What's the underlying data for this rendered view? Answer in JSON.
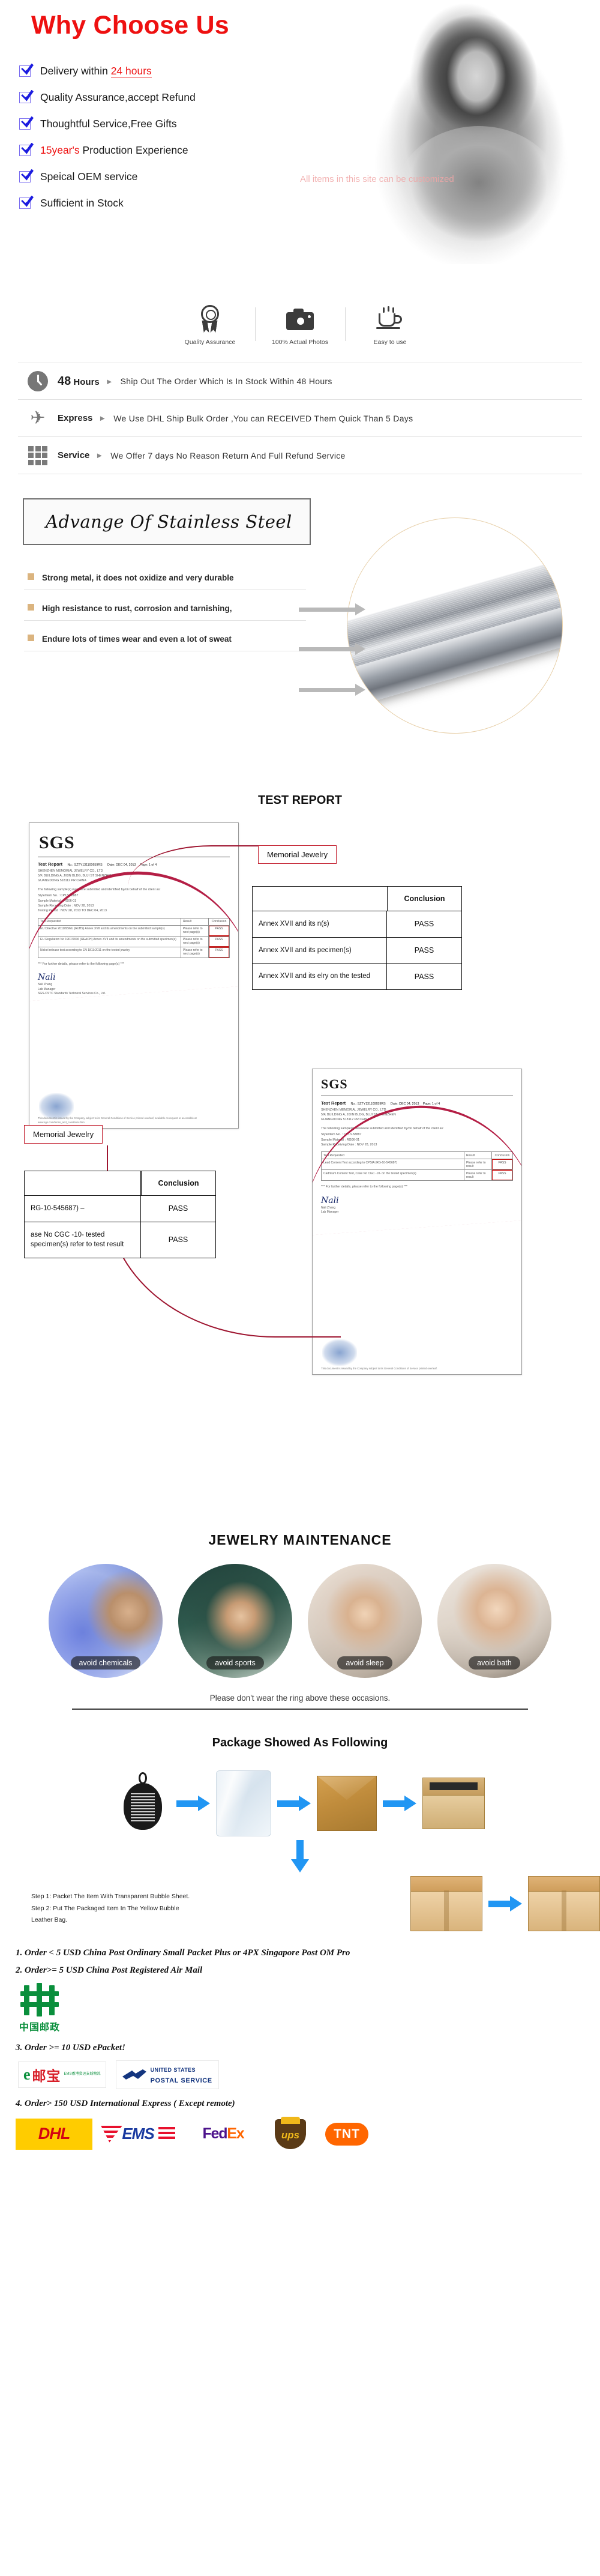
{
  "why": {
    "title": "Why Choose Us",
    "watermark": "All items in this site can be customized",
    "items": [
      {
        "pre": "Delivery within ",
        "hl": "24 hours",
        "hl_style": "underline",
        "post": ""
      },
      {
        "pre": "Quality Assurance,accept Refund",
        "hl": "",
        "hl_style": "",
        "post": ""
      },
      {
        "pre": "Thoughtful Service,Free Gifts",
        "hl": "",
        "hl_style": "",
        "post": ""
      },
      {
        "pre": "",
        "hl": "15year's",
        "hl_style": "plain",
        "post": " Production Experience"
      },
      {
        "pre": "Speical OEM service",
        "hl": "",
        "hl_style": "",
        "post": ""
      },
      {
        "pre": "Sufficient in Stock",
        "hl": "",
        "hl_style": "",
        "post": ""
      }
    ]
  },
  "badges": [
    {
      "icon": "quality-medal-icon",
      "caption": "Quality Assurance"
    },
    {
      "icon": "camera-icon",
      "caption": "100% Actual Photos"
    },
    {
      "icon": "coffee-cup-icon",
      "caption": "Easy to use"
    }
  ],
  "services": [
    {
      "icon": "clock-icon",
      "lead_num": "48",
      "lead": "Hours",
      "body": "Ship Out The Order Which Is In Stock Within 48 Hours"
    },
    {
      "icon": "airplane-icon",
      "lead_num": "",
      "lead": "Express",
      "body": "We Use DHL Ship Bulk Order ,You can RECEIVED Them Quick Than 5 Days"
    },
    {
      "icon": "grid-icon",
      "lead_num": "",
      "lead": "Service",
      "body": "We Offer 7 days No Reason Return And Full Refund Service"
    }
  ],
  "steel": {
    "heading": "Advange Of Stainless Steel",
    "points": [
      "Strong metal, it does not oxidize and very durable",
      "High resistance to rust, corrosion and tarnishing,",
      "Endure lots of times wear and even a lot of sweat"
    ]
  },
  "test_report": {
    "title": "TEST REPORT",
    "label_a": "Memorial Jewelry",
    "label_b": "Memorial Jewelry",
    "table_a": {
      "header_left": "",
      "header_right": "Conclusion",
      "rows": [
        {
          "left": "Annex XVII and its n(s)",
          "right": "PASS"
        },
        {
          "left": "Annex XVII and its pecimen(s)",
          "right": "PASS"
        },
        {
          "left": "Annex XVII and its elry on the tested",
          "right": "PASS"
        }
      ]
    },
    "table_b": {
      "header_right": "Conclusion",
      "rows": [
        {
          "left": "RG-10-545687) –",
          "right": "PASS"
        },
        {
          "left": "ase No CGC -10- tested specimen(s)  refer to test result",
          "right": "PASS"
        }
      ]
    },
    "doc_a": {
      "logo": "SGS",
      "heading": "Test Report",
      "meta_no": "No.: SZTY131100659RS",
      "meta_date": "Date: DEC 04, 2013",
      "meta_page": "Page: 1 of 4",
      "client_lines": [
        "SHENZHEN MEMORIAL JEWELRY CO., LTD",
        "5/F, BUILDING A, JIXIN BLDG, BUJI ST SHENZHEN",
        "GUANGDONG 518112 PR CHINA"
      ],
      "intro": "The following sample(s) was/were submitted and identified by/on behalf of the client as:",
      "kv": [
        "Style/Item No.   : CP13-58887",
        "Sample Material  : RG06-01",
        "Sample Receiving Date : NOV 28, 2013",
        "Testing Period   : NOV 28, 2013 TO DEC 04, 2013"
      ],
      "table_head": [
        "Test Requested",
        "Result",
        "Conclusion"
      ],
      "table_rows": [
        [
          "EU Directive 2011/65/EU (RoHS) Annex XVII and its amendments on the submitted sample(s)",
          "Please refer to next page(s)",
          "PASS"
        ],
        [
          "EU Regulation No 1907/2006 (REACH) Annex XVII and its amendments on the submitted specimen(s)",
          "Please refer to next page(s)",
          "PASS"
        ],
        [
          "Nickel release test according to EN 1811:2011 on the tested jewelry",
          "Please refer to next page(s)",
          "PASS"
        ]
      ],
      "note": "*** For further details, please refer to the following page(s) ***",
      "signature": "Nali",
      "sign_sub": [
        "Nali Zhang",
        "Lab Manager",
        "SGS-CSTC Standards Technical Services Co., Ltd."
      ],
      "footer": "This document is issued by the Company subject to its General Conditions of Service printed overleaf, available on request or accessible at www.sgs.com/terms_and_conditions.htm"
    },
    "doc_b": {
      "logo": "SGS",
      "heading": "Test Report",
      "meta_no": "No.: SZTY131100659RS",
      "meta_date": "Date: DEC 04, 2013",
      "meta_page": "Page: 1 of 4",
      "client_lines": [
        "SHENZHEN MEMORIAL JEWELRY CO., LTD",
        "5/F, BUILDING A, JIXIN BLDG, BUJI ST SHENZHEN",
        "GUANGDONG 518112 PR CHINA"
      ],
      "intro": "The following sample(s) was/were submitted and identified by/on behalf of the client as:",
      "kv": [
        "Style/Item No.   : CP13-58887",
        "Sample Material  : RG06-01",
        "Sample Receiving Date : NOV 28, 2013"
      ],
      "table_head": [
        "Test Requested",
        "Result",
        "Conclusion"
      ],
      "table_rows": [
        [
          "Lead Content Test according to CPSIA (RG-10-545687)",
          "Please refer to result",
          "PASS"
        ],
        [
          "Cadmium Content Test, Case No CGC -10- on the tested specimen(s)",
          "Please refer to result",
          "PASS"
        ]
      ],
      "note": "*** For further details, please refer to the following page(s) ***",
      "signature": "Nali",
      "sign_sub": [
        "Nali Zhang",
        "Lab Manager"
      ],
      "footer": "This document is issued by the Company subject to its General Conditions of Service printed overleaf."
    }
  },
  "maintenance": {
    "title": "JEWELRY MAINTENANCE",
    "items": [
      {
        "caption": "avoid chemicals"
      },
      {
        "caption": "avoid sports"
      },
      {
        "caption": "avoid sleep"
      },
      {
        "caption": "avoid bath"
      }
    ],
    "note": "Please don't wear the ring above these occasions."
  },
  "package": {
    "title": "Package Showed As Following",
    "steps": [
      "Step 1: Packet The Item With Transparent Bubble Sheet.",
      "Step 2: Put The Packaged Item In The Yellow Bubble",
      "              Leather Bag."
    ]
  },
  "shipping": {
    "lines": [
      "1. Order < 5 USD China Post Ordinary Small Packet Plus or 4PX Singapore Post OM Pro",
      "2. Order>= 5 USD  China Post Registered Air Mail",
      "3. Order >= 10 USD   ePacket!",
      "4. Order> 150 USD  International Express ( Except remote)"
    ],
    "chinapost_text": "中国邮政",
    "epacket": {
      "e": "e",
      "cn": "邮宝",
      "sub1": "EMS香港货运支线物流",
      "sub2": ""
    },
    "usps": {
      "line1": "UNITED STATES",
      "line2": "POSTAL SERVICE"
    },
    "couriers": [
      {
        "name": "DHL",
        "label": "DHL"
      },
      {
        "name": "EMS",
        "label": "EMS"
      },
      {
        "name": "FedEx",
        "label_a": "Fed",
        "label_b": "Ex"
      },
      {
        "name": "UPS",
        "label": "ups"
      },
      {
        "name": "TNT",
        "label": "TNT"
      }
    ]
  }
}
